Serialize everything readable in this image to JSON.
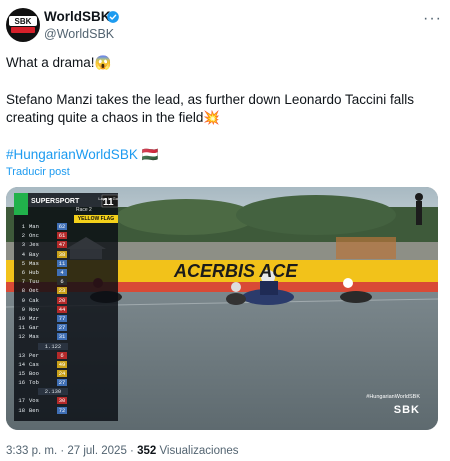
{
  "account": {
    "name": "WorldSBK",
    "handle": "@WorldSBK",
    "avatar_text": "SBK"
  },
  "post": {
    "line1": "What a drama!😱",
    "line2": "Stefano Manzi takes the lead, as further down Leonardo Taccini falls creating quite a chaos in the field💥",
    "hashtag": "#HungarianWorldSBK 🇭🇺",
    "translate": "Traducir post"
  },
  "media": {
    "series": "SUPERSPORT",
    "race": "Race 2",
    "laps": "11",
    "laps_label": "Laps to Go",
    "flag": "YELLOW FLAG",
    "banner": "ACERBIS ACE",
    "watermark_top": "#HungarianWorldSBK",
    "watermark": "SBK",
    "standings": [
      {
        "pos": "1",
        "name": "Man",
        "num": "62",
        "color": "#3f6fb5"
      },
      {
        "pos": "2",
        "name": "Onc",
        "num": "61",
        "color": "#b52a2a"
      },
      {
        "pos": "3",
        "name": "Jes",
        "num": "47",
        "color": "#b52a2a"
      },
      {
        "pos": "4",
        "name": "Bay",
        "num": "38",
        "color": "#c9a019"
      },
      {
        "pos": "5",
        "name": "Mas",
        "num": "11",
        "color": "#3f6fb5"
      },
      {
        "pos": "6",
        "name": "Hub",
        "num": "4",
        "color": "#3f6fb5"
      },
      {
        "pos": "7",
        "name": "Tuu",
        "num": "6",
        "color": "#2d2d2d"
      },
      {
        "pos": "8",
        "name": "Oet",
        "num": "23",
        "color": "#c9a019"
      },
      {
        "pos": "9",
        "name": "Cak",
        "num": "20",
        "color": "#b52a2a"
      },
      {
        "pos": "9",
        "name": "Nov",
        "num": "44",
        "color": "#b52a2a"
      },
      {
        "pos": "10",
        "name": "Mzr",
        "num": "77",
        "color": "#3f6fb5"
      },
      {
        "pos": "11",
        "name": "Gar",
        "num": "27",
        "color": "#3f6fb5"
      },
      {
        "pos": "12",
        "name": "Mas",
        "num": "31",
        "color": "#3f6fb5"
      },
      {
        "pos": "13",
        "name": "Per",
        "num": "6",
        "color": "#b52a2a"
      },
      {
        "pos": "14",
        "name": "Cas",
        "num": "49",
        "color": "#c9a019"
      },
      {
        "pos": "15",
        "name": "Boo",
        "num": "24",
        "color": "#c9a019"
      },
      {
        "pos": "16",
        "name": "Tob",
        "num": "27",
        "color": "#3f6fb5"
      },
      {
        "pos": "17",
        "name": "Vos",
        "num": "30",
        "color": "#b52a2a"
      },
      {
        "pos": "18",
        "name": "Ben",
        "num": "72",
        "color": "#3f6fb5"
      }
    ],
    "gaps": [
      "1.122",
      "2.130"
    ]
  },
  "meta": {
    "time": "3:33 p. m.",
    "date": "27 jul. 2025",
    "views_count": "352",
    "views_label": "Visualizaciones"
  },
  "colors": {
    "accent": "#1d9bf0",
    "secondary": "#536471",
    "verified": "#1d9bf0"
  }
}
